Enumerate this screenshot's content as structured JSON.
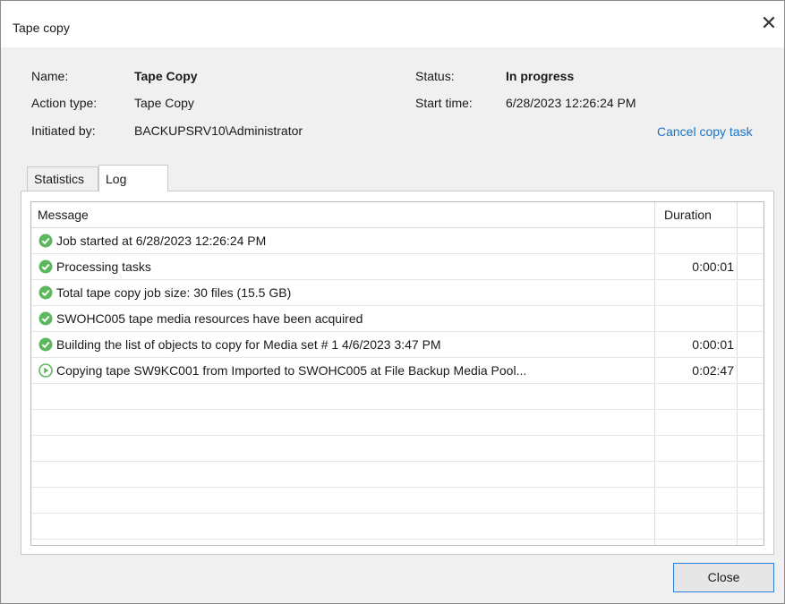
{
  "window": {
    "title": "Tape copy"
  },
  "details": {
    "name_label": "Name:",
    "name_value": "Tape Copy",
    "action_label": "Action type:",
    "action_value": "Tape Copy",
    "initiated_label": "Initiated by:",
    "initiated_value": "BACKUPSRV10\\Administrator",
    "status_label": "Status:",
    "status_value": "In progress",
    "start_label": "Start time:",
    "start_value": "6/28/2023 12:26:24 PM",
    "cancel_link": "Cancel copy task"
  },
  "tabs": [
    {
      "label": "Statistics",
      "active": false
    },
    {
      "label": "Log",
      "active": true
    }
  ],
  "log": {
    "columns": {
      "message": "Message",
      "duration": "Duration"
    },
    "rows": [
      {
        "icon": "success-icon",
        "message": "Job started at 6/28/2023 12:26:24 PM",
        "duration": ""
      },
      {
        "icon": "success-icon",
        "message": "Processing tasks",
        "duration": "0:00:01"
      },
      {
        "icon": "success-icon",
        "message": "Total tape copy job size: 30 files  (15.5 GB)",
        "duration": ""
      },
      {
        "icon": "success-icon",
        "message": "SWOHC005 tape media resources have been acquired",
        "duration": ""
      },
      {
        "icon": "success-icon",
        "message": "Building the list of objects to copy for Media set # 1 4/6/2023 3:47 PM",
        "duration": "0:00:01"
      },
      {
        "icon": "running-icon",
        "message": "Copying tape SW9KC001 from Imported to SWOHC005 at File Backup Media Pool...",
        "duration": "0:02:47"
      }
    ]
  },
  "footer": {
    "close_label": "Close"
  },
  "colors": {
    "success": "#5cb85c",
    "link": "#1a73c8",
    "accent_border": "#2a7fd4"
  }
}
